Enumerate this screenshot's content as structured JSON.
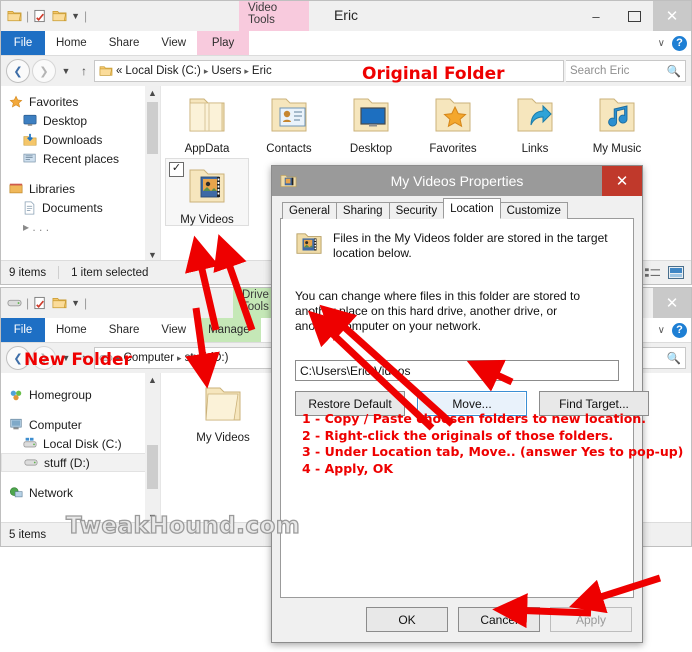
{
  "window_top": {
    "title": "Eric",
    "contextual_tab_group": "Video Tools",
    "quick_access_icons": [
      "folder-icon",
      "properties-icon",
      "new-folder-icon",
      "dropdown-arrow-icon"
    ],
    "window_buttons": {
      "minimize": "–",
      "maximize": "☐",
      "close": "✕"
    },
    "ribbon_tabs": [
      "File",
      "Home",
      "Share",
      "View",
      "Play"
    ],
    "help_icon": "?",
    "collapse_ribbon_icon": "∨",
    "breadcrumb": {
      "overflow": "«",
      "items": [
        "Local Disk (C:)",
        "Users",
        "Eric"
      ],
      "separator": "▸"
    },
    "search": {
      "placeholder": "Search Eric",
      "icon": "search-icon"
    },
    "nav_pane": [
      {
        "label": "Favorites",
        "icon": "star-icon",
        "indent": 0,
        "selected": false
      },
      {
        "label": "Desktop",
        "icon": "monitor-icon",
        "indent": 1,
        "selected": false
      },
      {
        "label": "Downloads",
        "icon": "download-icon",
        "indent": 1,
        "selected": false
      },
      {
        "label": "Recent places",
        "icon": "recent-icon",
        "indent": 1,
        "selected": false
      },
      {
        "label": "Libraries",
        "icon": "libraries-icon",
        "indent": 0,
        "selected": false
      },
      {
        "label": "Documents",
        "icon": "document-icon",
        "indent": 1,
        "selected": false
      }
    ],
    "files": [
      {
        "label": "AppData",
        "icon": "folder-plain-icon",
        "selected": false,
        "checked": false
      },
      {
        "label": "Contacts",
        "icon": "folder-contacts-icon",
        "selected": false,
        "checked": false
      },
      {
        "label": "Desktop",
        "icon": "folder-desktop-icon",
        "selected": false,
        "checked": false
      },
      {
        "label": "Favorites",
        "icon": "folder-favorites-icon",
        "selected": false,
        "checked": false
      },
      {
        "label": "Links",
        "icon": "folder-links-icon",
        "selected": false,
        "checked": false
      },
      {
        "label": "My Music",
        "icon": "folder-music-icon",
        "selected": false,
        "checked": false
      },
      {
        "label": "My Videos",
        "icon": "folder-videos-icon",
        "selected": true,
        "checked": true
      }
    ],
    "status": {
      "count": "9 items",
      "selection": "1 item selected"
    },
    "view_buttons": [
      "details-view-icon",
      "large-icons-view-icon"
    ]
  },
  "window_bottom": {
    "title": "",
    "contextual_tab_group": "Drive Tools",
    "quick_access_icons": [
      "drive-icon",
      "properties-icon",
      "new-folder-icon",
      "dropdown-arrow-icon"
    ],
    "window_buttons": {
      "close": "✕"
    },
    "ribbon_tabs": [
      "File",
      "Home",
      "Share",
      "View",
      "Manage"
    ],
    "help_icon": "?",
    "collapse_ribbon_icon": "∨",
    "breadcrumb": {
      "items": [
        "Computer",
        "stuff (D:)"
      ],
      "separator": "▸"
    },
    "nav_pane": [
      {
        "label": "Homegroup",
        "icon": "homegroup-icon",
        "indent": 0,
        "selected": false
      },
      {
        "label": "Computer",
        "icon": "computer-icon",
        "indent": 0,
        "selected": false
      },
      {
        "label": "Local Disk (C:)",
        "icon": "harddisk-icon",
        "indent": 1,
        "selected": false
      },
      {
        "label": "stuff (D:)",
        "icon": "drive-icon",
        "indent": 1,
        "selected": true
      },
      {
        "label": "Network",
        "icon": "network-icon",
        "indent": 0,
        "selected": false
      }
    ],
    "files": [
      {
        "label": "My Videos",
        "icon": "folder-plain-icon",
        "selected": false,
        "checked": false
      }
    ],
    "status": {
      "count": "5 items",
      "selection": ""
    }
  },
  "dialog": {
    "title": "My Videos Properties",
    "icon": "folder-videos-icon",
    "close_label": "✕",
    "tabs": [
      "General",
      "Sharing",
      "Security",
      "Location",
      "Customize"
    ],
    "active_tab": "Location",
    "para1": "Files in the My Videos folder are stored in the target location below.",
    "para2": "You can change where files in this folder are stored to another place on this hard drive, another drive, or another computer on your network.",
    "path_value": "C:\\Users\\Eric\\Videos",
    "buttons": {
      "restore": "Restore Default",
      "move": "Move...",
      "find": "Find Target..."
    },
    "footer": {
      "ok": "OK",
      "cancel": "Cancel",
      "apply": "Apply"
    }
  },
  "annotations": {
    "label_original": "Original Folder",
    "label_new": "New Folder",
    "steps": [
      "1 - Copy / Paste choosen folders to new location.",
      "2 - Right-click the originals of those folders.",
      "3 - Under Location tab, Move.. (answer Yes to pop-up)",
      "4 - Apply, OK"
    ],
    "color": "#ee0000",
    "watermark": "TweakHound.com"
  }
}
